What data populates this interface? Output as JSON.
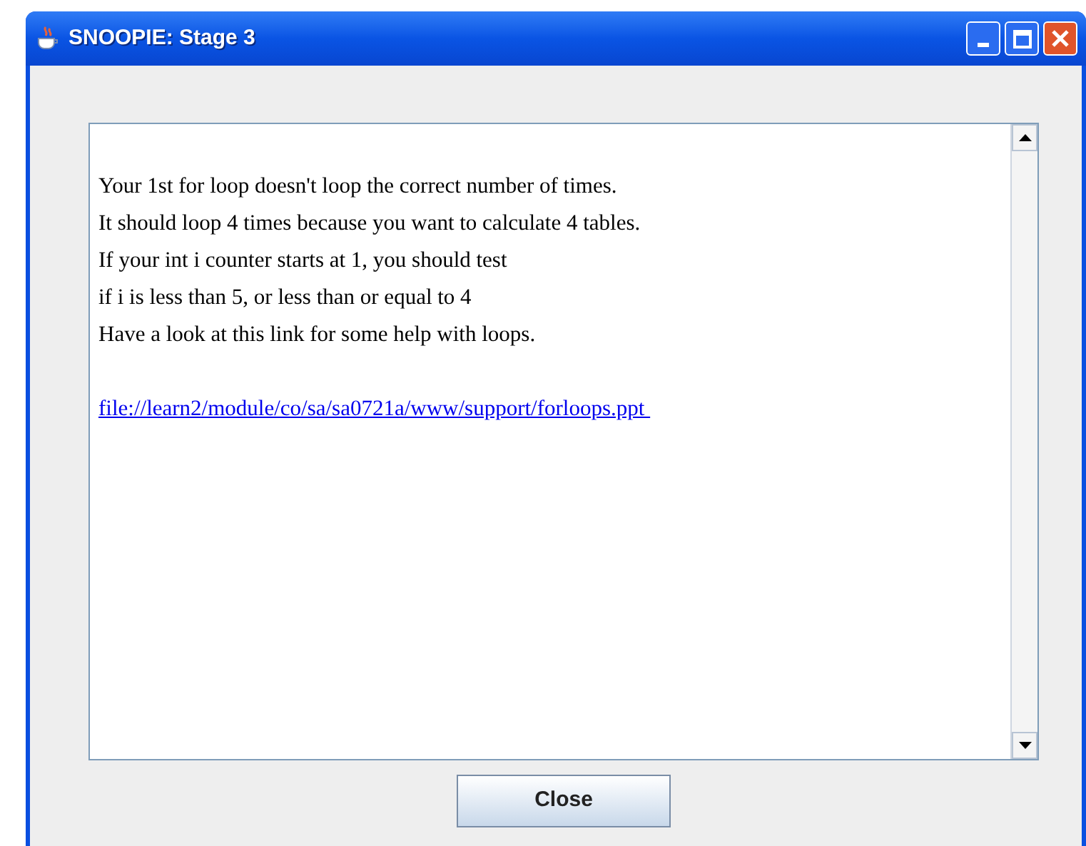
{
  "window": {
    "title": "SNOOPIE: Stage 3"
  },
  "message": {
    "lines": [
      "Your 1st for loop doesn't loop the correct number of times.",
      "It should loop 4 times because you want to calculate 4 tables.",
      "If your int i counter starts at 1, you should test",
      "if i is less than 5, or less than or equal to 4",
      "Have a look at this link for some help with loops."
    ],
    "link": "file://learn2/module/co/sa/sa0721a/www/support/forloops.ppt "
  },
  "buttons": [
    "Close"
  ]
}
